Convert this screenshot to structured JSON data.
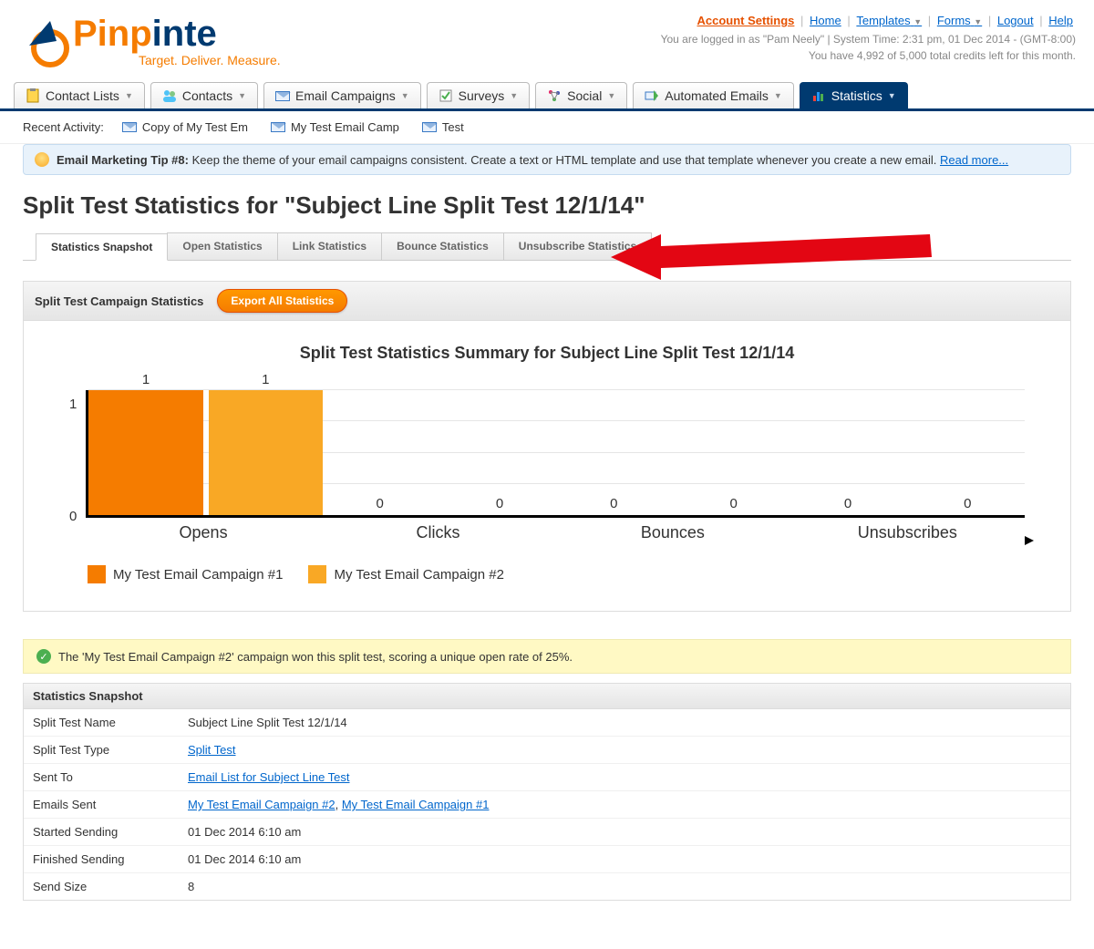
{
  "brand": {
    "name1": "Pinp",
    "name2": "inte",
    "tagline": "Target. Deliver. Measure."
  },
  "header": {
    "links": {
      "account": "Account Settings",
      "home": "Home",
      "templates": "Templates",
      "forms": "Forms",
      "logout": "Logout",
      "help": "Help"
    },
    "logged_in": "You are logged in as \"Pam Neely\" | System Time: 2:31 pm, 01 Dec 2014 - (GMT-8:00)",
    "credits": "You have 4,992 of 5,000 total credits left for this month."
  },
  "nav": {
    "contact_lists": "Contact Lists",
    "contacts": "Contacts",
    "email_campaigns": "Email Campaigns",
    "surveys": "Surveys",
    "social": "Social",
    "automated_emails": "Automated Emails",
    "statistics": "Statistics"
  },
  "recent": {
    "label": "Recent Activity:",
    "items": [
      "Copy of My Test Em",
      "My Test Email Camp",
      "Test"
    ]
  },
  "tip": {
    "title": "Email Marketing Tip #8:",
    "body": " Keep the theme of your email campaigns consistent. Create a text or HTML template and use that template whenever you create a new email. ",
    "read_more": "Read more..."
  },
  "page_title": "Split Test Statistics for \"Subject Line Split Test 12/1/14\"",
  "sub_tabs": [
    "Statistics Snapshot",
    "Open Statistics",
    "Link Statistics",
    "Bounce Statistics",
    "Unsubscribe Statistics"
  ],
  "stats_bar": {
    "label": "Split Test Campaign Statistics",
    "export": "Export All Statistics"
  },
  "chart_title": "Split Test Statistics Summary for Subject Line Split Test 12/1/14",
  "chart_data": {
    "type": "bar",
    "categories": [
      "Opens",
      "Clicks",
      "Bounces",
      "Unsubscribes"
    ],
    "series": [
      {
        "name": "My Test Email Campaign #1",
        "color": "#f57c00",
        "values": [
          1,
          0,
          0,
          0
        ]
      },
      {
        "name": "My Test Email Campaign #2",
        "color": "#f9a825",
        "values": [
          1,
          0,
          0,
          0
        ]
      }
    ],
    "ylim": [
      0,
      1
    ],
    "y_ticks": [
      0,
      1
    ]
  },
  "winner": "The 'My Test Email Campaign #2' campaign won this split test, scoring a unique open rate of 25%.",
  "snapshot": {
    "heading": "Statistics Snapshot",
    "rows": [
      {
        "k": "Split Test Name",
        "v": "Subject Line Split Test 12/1/14",
        "link": false
      },
      {
        "k": "Split Test Type",
        "v": "Split Test",
        "link": true
      },
      {
        "k": "Sent To",
        "v": "Email List for Subject Line Test",
        "link": true
      },
      {
        "k": "Emails Sent",
        "v_html": [
          "My Test Email Campaign #2",
          ", ",
          "My Test Email Campaign #1"
        ],
        "link": true
      },
      {
        "k": "Started Sending",
        "v": "01 Dec 2014 6:10 am",
        "link": false
      },
      {
        "k": "Finished Sending",
        "v": "01 Dec 2014 6:10 am",
        "link": false
      },
      {
        "k": "Send Size",
        "v": "8",
        "link": false
      }
    ]
  }
}
